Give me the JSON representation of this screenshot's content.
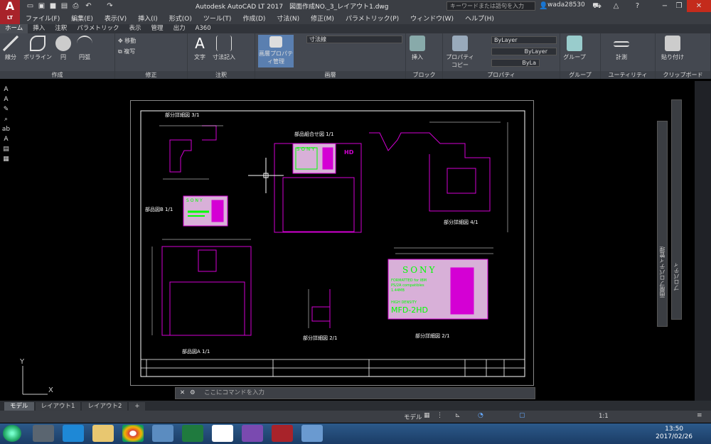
{
  "app": {
    "title": "Autodesk AutoCAD LT 2017　図面作成NO._3_レイアウト1.dwg",
    "search_placeholder": "キーワードまたは語句を入力",
    "user": "wada28530",
    "logo": "A",
    "logo_sub": "LT"
  },
  "menus": [
    "ファイル(F)",
    "編集(E)",
    "表示(V)",
    "挿入(I)",
    "形式(O)",
    "ツール(T)",
    "作成(D)",
    "寸法(N)",
    "修正(M)",
    "パラメトリック(P)",
    "ウィンドウ(W)",
    "ヘルプ(H)"
  ],
  "ribbon_tabs": [
    "ホーム",
    "挿入",
    "注釈",
    "パラメトリック",
    "表示",
    "管理",
    "出力",
    "A360"
  ],
  "ribbon": {
    "draw": {
      "label": "作成",
      "line": "線分",
      "polyline": "ポリライン",
      "circle": "円",
      "arc": "円弧"
    },
    "modify": {
      "label": "修正",
      "move": "移動",
      "copy": "複写"
    },
    "annotation": {
      "label": "注釈",
      "text": "文字",
      "dimension": "寸法記入"
    },
    "layers": {
      "label": "画層",
      "properties": "画層プロパティ管理",
      "current_layer": "寸法線"
    },
    "block": {
      "label": "ブロック",
      "insert": "挿入"
    },
    "properties": {
      "label": "プロパティ",
      "copy": "プロパティコピー",
      "color": "ByLayer",
      "linetype": "ByLayer",
      "lineweight": "ByLa"
    },
    "groups": {
      "label": "グループ",
      "group": "グループ"
    },
    "utilities": {
      "label": "ユーティリティ",
      "measure": "計測"
    },
    "clipboard": {
      "label": "クリップボード",
      "paste": "貼り付け"
    }
  },
  "drawing": {
    "title_assembly": "部品組合せ図 1/1",
    "detail3": "部分詳細図 3/1",
    "detail4": "部分詳細図 4/1",
    "partB": "部品図B 1/1",
    "partA": "部品図A 1/1",
    "detail2": "部分詳細図 2/1",
    "detail_label": "部分詳細図 2/1",
    "sony": "SONY",
    "formatted": "FORMATTED for IBM",
    "compat": "PS/2A compatibles",
    "cap": "1.44MB",
    "density": "HIGH DENSITY",
    "model": "MFD-2HD",
    "hd": "HD"
  },
  "command": {
    "placeholder": "ここにコマンドを入力"
  },
  "layout_tabs": [
    "モデル",
    "レイアウト1",
    "レイアウト2"
  ],
  "status": {
    "model": "モデル",
    "scale": "1:1"
  },
  "right_panels": {
    "layer_props": "画層プロパティ管理",
    "properties": "プロパティ"
  },
  "clock": {
    "time": "13:50",
    "date": "2017/02/26"
  },
  "colors": {
    "accent": "#a8232a",
    "magenta": "#d400d4",
    "green": "#00ff00",
    "paper": "#000000"
  }
}
